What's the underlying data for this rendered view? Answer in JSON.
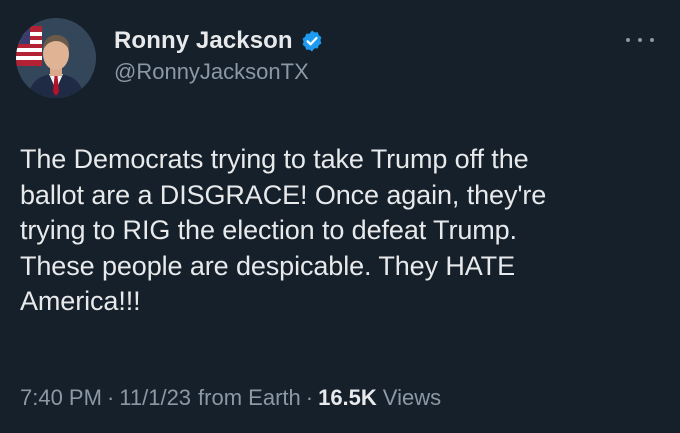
{
  "author": {
    "display_name": "Ronny Jackson",
    "handle": "@RonnyJacksonTX",
    "verified": true
  },
  "tweet": {
    "lines": [
      "The Democrats trying to take Trump off the",
      "ballot are a DISGRACE! Once again, they're",
      "trying to RIG the election to defeat Trump.",
      "These people are despicable. They HATE",
      "America!!!"
    ]
  },
  "meta": {
    "time": "7:40 PM",
    "separator": "·",
    "date": "11/1/23",
    "source": "from Earth",
    "views_count": "16.5K",
    "views_label": "Views"
  },
  "colors": {
    "background": "#15202b",
    "text_primary": "#e7e9ea",
    "text_secondary": "#8b98a5",
    "verified_blue": "#1d9bf0"
  },
  "icons": {
    "verified": "verified-badge-icon",
    "more": "more-options-icon"
  }
}
